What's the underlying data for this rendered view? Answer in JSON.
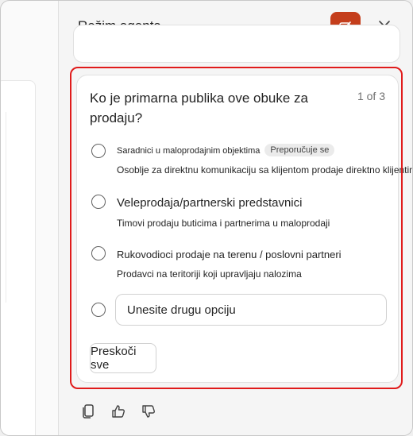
{
  "panel": {
    "title": "Režim agenta",
    "accent_color": "#c43e1c",
    "highlight_color": "#e01b1b",
    "icons": [
      "compose-icon",
      "close-icon",
      "copy-icon",
      "thumbs-up-icon",
      "thumbs-down-icon"
    ]
  },
  "question": {
    "text": "Ko je primarna publika ove obuke za prodaju?",
    "counter": "1 of 3",
    "options": [
      {
        "title": "Saradnici u maloprodajnim objektima",
        "badge": "Preporučuje se",
        "description": "Osoblje za direktnu komunikaciju sa klijentom prodaje direktno klijentima"
      },
      {
        "title": "Veleprodaja/partnerski predstavnici",
        "description": "Timovi prodaju buticima i partnerima u maloprodaji"
      },
      {
        "title": "Rukovodioci prodaje na terenu / poslovni partneri",
        "description": "Prodavci na teritoriji koji upravljaju nalozima"
      }
    ],
    "other_placeholder": "Unesite drugu opciju",
    "skip_label": "Preskoči sve"
  }
}
